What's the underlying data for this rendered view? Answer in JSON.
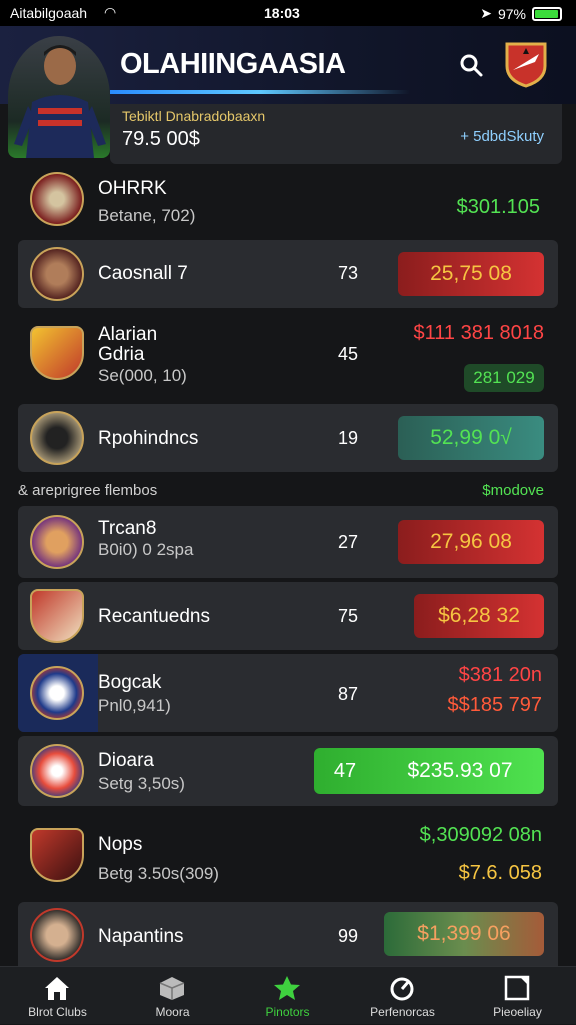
{
  "status_bar": {
    "carrier": "Aitabilgoaah",
    "time": "18:03",
    "battery": "97%",
    "battery_level": 0.97
  },
  "header": {
    "title": "OLAHIINGAASIA",
    "icons": [
      "search-icon",
      "club-crest-icon"
    ]
  },
  "summary": {
    "label": "Tebiktl Dnabradobaaxn",
    "value": "79.5 00$",
    "link": "+ 5dbdSkuty"
  },
  "rows": [
    {
      "name": "OHRRK",
      "sub": "Betane, 702)",
      "num": "",
      "price": "$301.105",
      "price_color": "#53e353",
      "pill": "",
      "pill_style": "",
      "logo_color": "#c0392b"
    },
    {
      "name": "Caosnall 7",
      "sub": "",
      "num": "73",
      "price": "",
      "pill": "25,75  08",
      "pill_style": "red",
      "logo_color": "#8e2b2b"
    },
    {
      "name": "Alarian",
      "name2": "Gdria",
      "sub": "Se(000, 10)",
      "num": "45",
      "price": "$111 381 8018",
      "price_color": "#ff4545",
      "pill": "281 029",
      "pill_style": "darkgreen-small",
      "logo_color": "#b8322a"
    },
    {
      "name": "Rpohindncs",
      "sub": "",
      "num": "19",
      "price": "",
      "pill": "52,99  0√",
      "pill_style": "teal",
      "logo_color": "#3a3a3a"
    },
    {
      "name": "Trcan8",
      "sub": "B0i0) 0 2spa",
      "num": "27",
      "price": "",
      "pill": "27,96  08",
      "pill_style": "red",
      "logo_color": "#4b2a2a"
    },
    {
      "name": "Recantuedns",
      "sub": "",
      "num": "75",
      "price": "",
      "pill": "$6,28  32",
      "pill_style": "red",
      "logo_color": "#8e2b2b"
    },
    {
      "name": "Bogcak",
      "sub": "Pnl0,941)",
      "num": "87",
      "price": "$381 20n",
      "price_color": "#ff4545",
      "price2": "$$185 797",
      "logo_color": "#1e3a8a"
    },
    {
      "name": "Dioara",
      "sub": "Setg 3,50s)",
      "num": "47",
      "price": "",
      "pill": "$235.93  07",
      "pill_style": "green",
      "logo_color": "#c0392b"
    },
    {
      "name": "Nops",
      "sub": "Betg 3.50s(309)",
      "num": "",
      "price": "$,309092 08n",
      "price_color": "#53e353",
      "price2": "$7.6. 058",
      "logo_color": "#b8322a"
    },
    {
      "name": "Napantins",
      "sub": "",
      "num": "99",
      "price": "",
      "pill": "$1,399  06",
      "pill_style": "darkgreen",
      "logo_color": "#555"
    }
  ],
  "section": {
    "left": "& areprigree flembos",
    "right": "$modove"
  },
  "tabs": [
    {
      "label": "Blrot Clubs",
      "icon": "home-icon"
    },
    {
      "label": "Moora",
      "icon": "box-icon"
    },
    {
      "label": "Pinotors",
      "icon": "star-icon",
      "active": true
    },
    {
      "label": "Perfenorcas",
      "icon": "gauge-icon"
    },
    {
      "label": "Pieoeliay",
      "icon": "square-icon"
    }
  ],
  "colors": {
    "accent_green": "#53e353",
    "accent_red": "#d43232",
    "header_bg": "#1b2140"
  }
}
